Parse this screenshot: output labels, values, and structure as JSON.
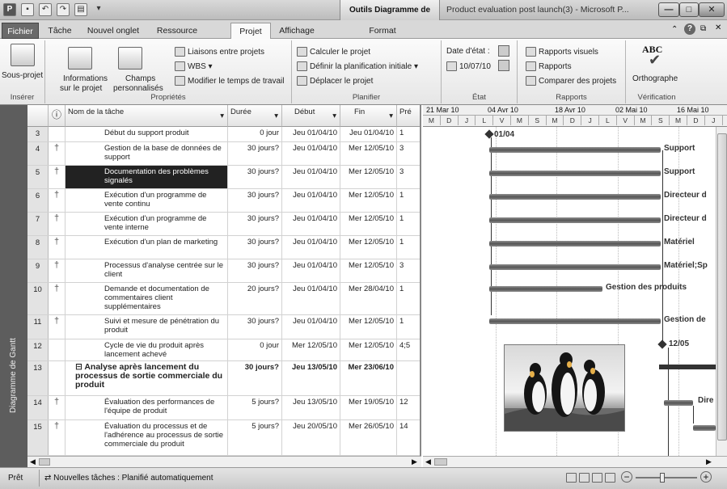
{
  "titlebar": {
    "context_tab": "Outils Diagramme de Gantt",
    "window_title": "Product evaluation post launch(3) - Microsoft P...",
    "app_icon": "project-app-icon"
  },
  "tabs": [
    {
      "label": "Fichier"
    },
    {
      "label": "Tâche"
    },
    {
      "label": "Nouvel onglet"
    },
    {
      "label": "Ressource"
    },
    {
      "label": "Projet"
    },
    {
      "label": "Affichage"
    },
    {
      "label": "Format"
    }
  ],
  "ribbon": {
    "inserer": {
      "label": "Insérer",
      "subproject": "Sous-projet"
    },
    "proprietes": {
      "label": "Propriétés",
      "info_line1": "Informations",
      "info_line2": "sur le projet",
      "fields_line1": "Champs",
      "fields_line2": "personnalisés",
      "links": "Liaisons entre projets",
      "wbs": "WBS ▾",
      "worktime": "Modifier le temps de travail"
    },
    "planifier": {
      "label": "Planifier",
      "compute": "Calculer le projet",
      "baseline": "Définir la planification initiale ▾",
      "move": "Déplacer le projet"
    },
    "etat": {
      "label": "État",
      "status_date_label": "Date d'état :",
      "status_date": "10/07/10"
    },
    "rapports": {
      "label": "Rapports",
      "visual": "Rapports visuels",
      "reports": "Rapports",
      "compare": "Comparer des projets"
    },
    "verification": {
      "label": "Vérification",
      "spelling": "Orthographe",
      "spelling_icon": "ABC"
    }
  },
  "sidebar": {
    "label": "Diagramme de Gantt"
  },
  "grid": {
    "headers": {
      "info": "ⓘ",
      "name": "Nom de la tâche",
      "duration": "Durée",
      "start": "Début",
      "end": "Fin",
      "pred": "Pré"
    },
    "rows": [
      {
        "id": "3",
        "info": "",
        "name": "Début du support produit",
        "duration": "0 jour",
        "start": "Jeu 01/04/10",
        "end": "Jeu 01/04/10",
        "pred": "1"
      },
      {
        "id": "4",
        "info": "†",
        "name": "Gestion de la base de données de support",
        "duration": "30 jours?",
        "start": "Jeu 01/04/10",
        "end": "Mer 12/05/10",
        "pred": "3"
      },
      {
        "id": "5",
        "info": "†",
        "name": "Documentation des problèmes signalés",
        "duration": "30 jours?",
        "start": "Jeu 01/04/10",
        "end": "Mer 12/05/10",
        "pred": "3"
      },
      {
        "id": "6",
        "info": "†",
        "name": "Exécution d'un programme de vente continu",
        "duration": "30 jours?",
        "start": "Jeu 01/04/10",
        "end": "Mer 12/05/10",
        "pred": "1"
      },
      {
        "id": "7",
        "info": "†",
        "name": "Exécution d'un programme de vente interne",
        "duration": "30 jours?",
        "start": "Jeu 01/04/10",
        "end": "Mer 12/05/10",
        "pred": "1"
      },
      {
        "id": "8",
        "info": "†",
        "name": "Exécution d'un plan de marketing",
        "duration": "30 jours?",
        "start": "Jeu 01/04/10",
        "end": "Mer 12/05/10",
        "pred": "1"
      },
      {
        "id": "9",
        "info": "†",
        "name": "Processus d'analyse centrée sur le client",
        "duration": "30 jours?",
        "start": "Jeu 01/04/10",
        "end": "Mer 12/05/10",
        "pred": "3"
      },
      {
        "id": "10",
        "info": "†",
        "name": "Demande et documentation de commentaires client supplémentaires",
        "duration": "20 jours?",
        "start": "Jeu 01/04/10",
        "end": "Mer 28/04/10",
        "pred": "1"
      },
      {
        "id": "11",
        "info": "†",
        "name": "Suivi et mesure de pénétration du produit",
        "duration": "30 jours?",
        "start": "Jeu 01/04/10",
        "end": "Mer 12/05/10",
        "pred": "1"
      },
      {
        "id": "12",
        "info": "",
        "name": "Cycle de vie du produit après lancement achevé",
        "duration": "0 jour",
        "start": "Mer 12/05/10",
        "end": "Mer 12/05/10",
        "pred": "4;5"
      },
      {
        "id": "13",
        "info": "",
        "name": "⊟ Analyse après lancement du processus de sortie commerciale du produit",
        "duration": "30 jours?",
        "start": "Jeu 13/05/10",
        "end": "Mer 23/06/10",
        "pred": ""
      },
      {
        "id": "14",
        "info": "†",
        "name": "Évaluation des performances de l'équipe de produit",
        "duration": "5 jours?",
        "start": "Jeu 13/05/10",
        "end": "Mer 19/05/10",
        "pred": "12"
      },
      {
        "id": "15",
        "info": "†",
        "name": "Évaluation du processus et de l'adhérence au processus de sortie commerciale du produit",
        "duration": "5 jours?",
        "start": "Jeu 20/05/10",
        "end": "Mer 26/05/10",
        "pred": "14"
      }
    ]
  },
  "timeline": {
    "weeks": [
      "21 Mar 10",
      "04 Avr 10",
      "18 Avr 10",
      "02 Mai 10",
      "16 Mai 10"
    ],
    "days": [
      "M",
      "D",
      "J",
      "L",
      "V",
      "M",
      "S",
      "M",
      "D",
      "J",
      "L",
      "V",
      "M",
      "S",
      "M",
      "D",
      "J"
    ],
    "labels": {
      "milestone_start": "01/04",
      "r4": "Support",
      "r5": "Support",
      "r6": "Directeur d",
      "r7": "Directeur d",
      "r8": "Matériel",
      "r9": "Matériel;Sp",
      "r10": "Gestion des produits",
      "r11": "Gestion de",
      "milestone_end": "12/05",
      "r14": "Dire"
    }
  },
  "statusbar": {
    "ready": "Prêt",
    "new_tasks": "Nouvelles tâches : Planifié automatiquement"
  }
}
